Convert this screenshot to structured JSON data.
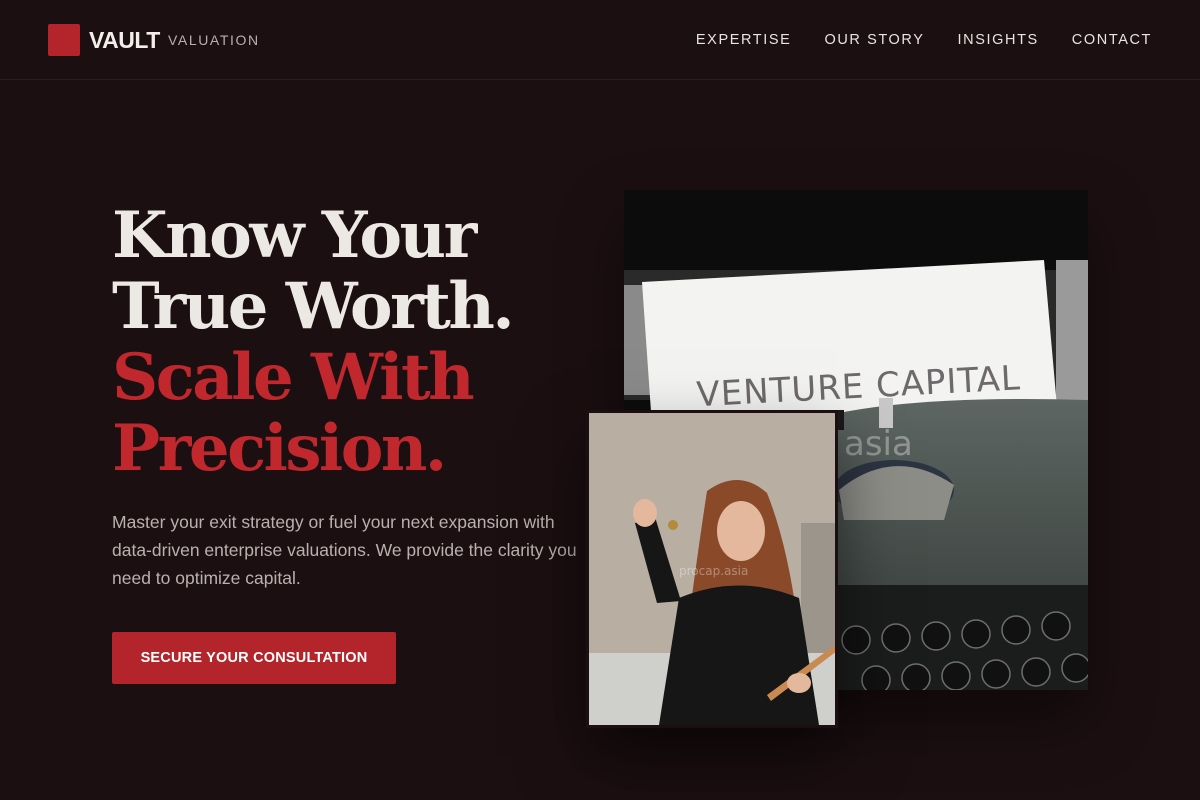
{
  "brand": {
    "name": "VAULT",
    "tagline": "VALUATION",
    "accent_color": "#b3252a"
  },
  "nav": {
    "items": [
      {
        "label": "EXPERTISE"
      },
      {
        "label": "OUR STORY"
      },
      {
        "label": "INSIGHTS"
      },
      {
        "label": "CONTACT"
      }
    ]
  },
  "hero": {
    "headline_line1": "Know Your",
    "headline_line2": "True Worth.",
    "headline_line3": "Scale With",
    "headline_line4": "Precision.",
    "description": "Master your exit strategy or fuel your next expansion with data-driven enterprise valuations. We provide the clarity you need to optimize capital.",
    "cta_label": "SECURE YOUR CONSULTATION"
  },
  "images": {
    "typewriter": {
      "paper_text": "VENTURE CAPITAL",
      "watermark": "asia"
    },
    "portrait": {
      "watermark": "procap.asia"
    }
  }
}
